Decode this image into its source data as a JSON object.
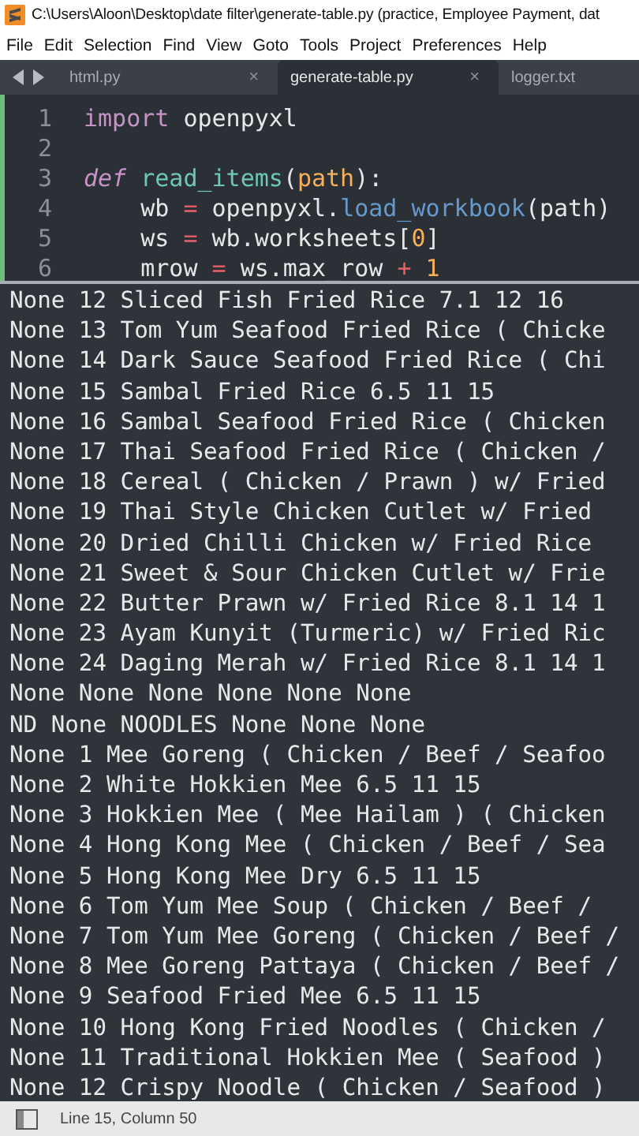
{
  "window": {
    "title": "C:\\Users\\Aloon\\Desktop\\date filter\\generate-table.py (practice, Employee Payment, dat"
  },
  "menu": [
    "File",
    "Edit",
    "Selection",
    "Find",
    "View",
    "Goto",
    "Tools",
    "Project",
    "Preferences",
    "Help"
  ],
  "tabs": [
    {
      "label": "html.py",
      "selected": false,
      "close": "×"
    },
    {
      "label": "generate-table.py",
      "selected": true,
      "close": "×"
    },
    {
      "label": "logger.txt",
      "selected": false
    }
  ],
  "editor": {
    "lines": [
      {
        "number": "1",
        "tokens": [
          {
            "kind": "keyword",
            "text": "import"
          },
          {
            "kind": "plain",
            "text": " openpyxl"
          }
        ]
      },
      {
        "number": "2"
      },
      {
        "number": "3",
        "tokens": [
          {
            "kind": "def",
            "text": "def"
          },
          {
            "kind": "func",
            "text": " read_items"
          },
          {
            "kind": "plain",
            "text": "("
          },
          {
            "kind": "param",
            "text": "path"
          },
          {
            "kind": "plain",
            "text": "):"
          }
        ]
      },
      {
        "number": "4",
        "tokens": [
          {
            "kind": "plain",
            "text": "    wb "
          },
          {
            "kind": "op",
            "text": "="
          },
          {
            "kind": "plain",
            "text": " openpyxl."
          },
          {
            "kind": "method",
            "text": "load_workbook"
          },
          {
            "kind": "plain",
            "text": "(path)"
          }
        ]
      },
      {
        "number": "5",
        "tokens": [
          {
            "kind": "plain",
            "text": "    ws "
          },
          {
            "kind": "op",
            "text": "="
          },
          {
            "kind": "plain",
            "text": " wb.worksheets["
          },
          {
            "kind": "number",
            "text": "0"
          },
          {
            "kind": "plain",
            "text": "]"
          }
        ]
      },
      {
        "number": "6",
        "tokens": [
          {
            "kind": "plain",
            "text": "    mrow "
          },
          {
            "kind": "op",
            "text": "="
          },
          {
            "kind": "plain",
            "text": " ws.max_row "
          },
          {
            "kind": "op",
            "text": "+"
          },
          {
            "kind": "number",
            "text": " 1"
          }
        ]
      }
    ]
  },
  "output": {
    "lines": [
      "None 12 Sliced Fish Fried Rice 7.1 12 16",
      "None 13 Tom Yum Seafood Fried Rice ( Chicke",
      "None 14 Dark Sauce Seafood Fried Rice ( Chi",
      "None 15 Sambal Fried Rice 6.5 11 15",
      "None 16 Sambal Seafood Fried Rice ( Chicken",
      "None 17 Thai Seafood Fried Rice ( Chicken /",
      "None 18 Cereal ( Chicken / Prawn ) w/ Fried",
      "None 19 Thai Style Chicken Cutlet w/ Fried",
      "None 20 Dried Chilli Chicken w/ Fried Rice",
      "None 21 Sweet & Sour Chicken Cutlet w/ Frie",
      "None 22 Butter Prawn w/ Fried Rice 8.1 14 1",
      "None 23 Ayam Kunyit (Turmeric) w/ Fried Ric",
      "None 24 Daging Merah w/ Fried Rice 8.1 14 1",
      "None None None None None None",
      "ND None NOODLES None None None",
      "None 1 Mee Goreng ( Chicken / Beef / Seafoo",
      "None 2 White Hokkien Mee 6.5 11 15",
      "None 3 Hokkien Mee ( Mee Hailam ) ( Chicken",
      "None 4 Hong Kong Mee ( Chicken / Beef / Sea",
      "None 5 Hong Kong Mee Dry 6.5 11 15",
      "None 6 Tom Yum Mee Soup ( Chicken / Beef /",
      "None 7 Tom Yum Mee Goreng ( Chicken / Beef /",
      "None 8 Mee Goreng Pattaya ( Chicken / Beef /",
      "None 9 Seafood Fried Mee 6.5 11 15",
      "None 10 Hong Kong Fried Noodles ( Chicken /",
      "None 11 Traditional Hokkien Mee ( Seafood )",
      "None 12 Crispy Noodle ( Chicken / Seafood )"
    ]
  },
  "status_bar": {
    "position": "Line 15, Column 50"
  }
}
